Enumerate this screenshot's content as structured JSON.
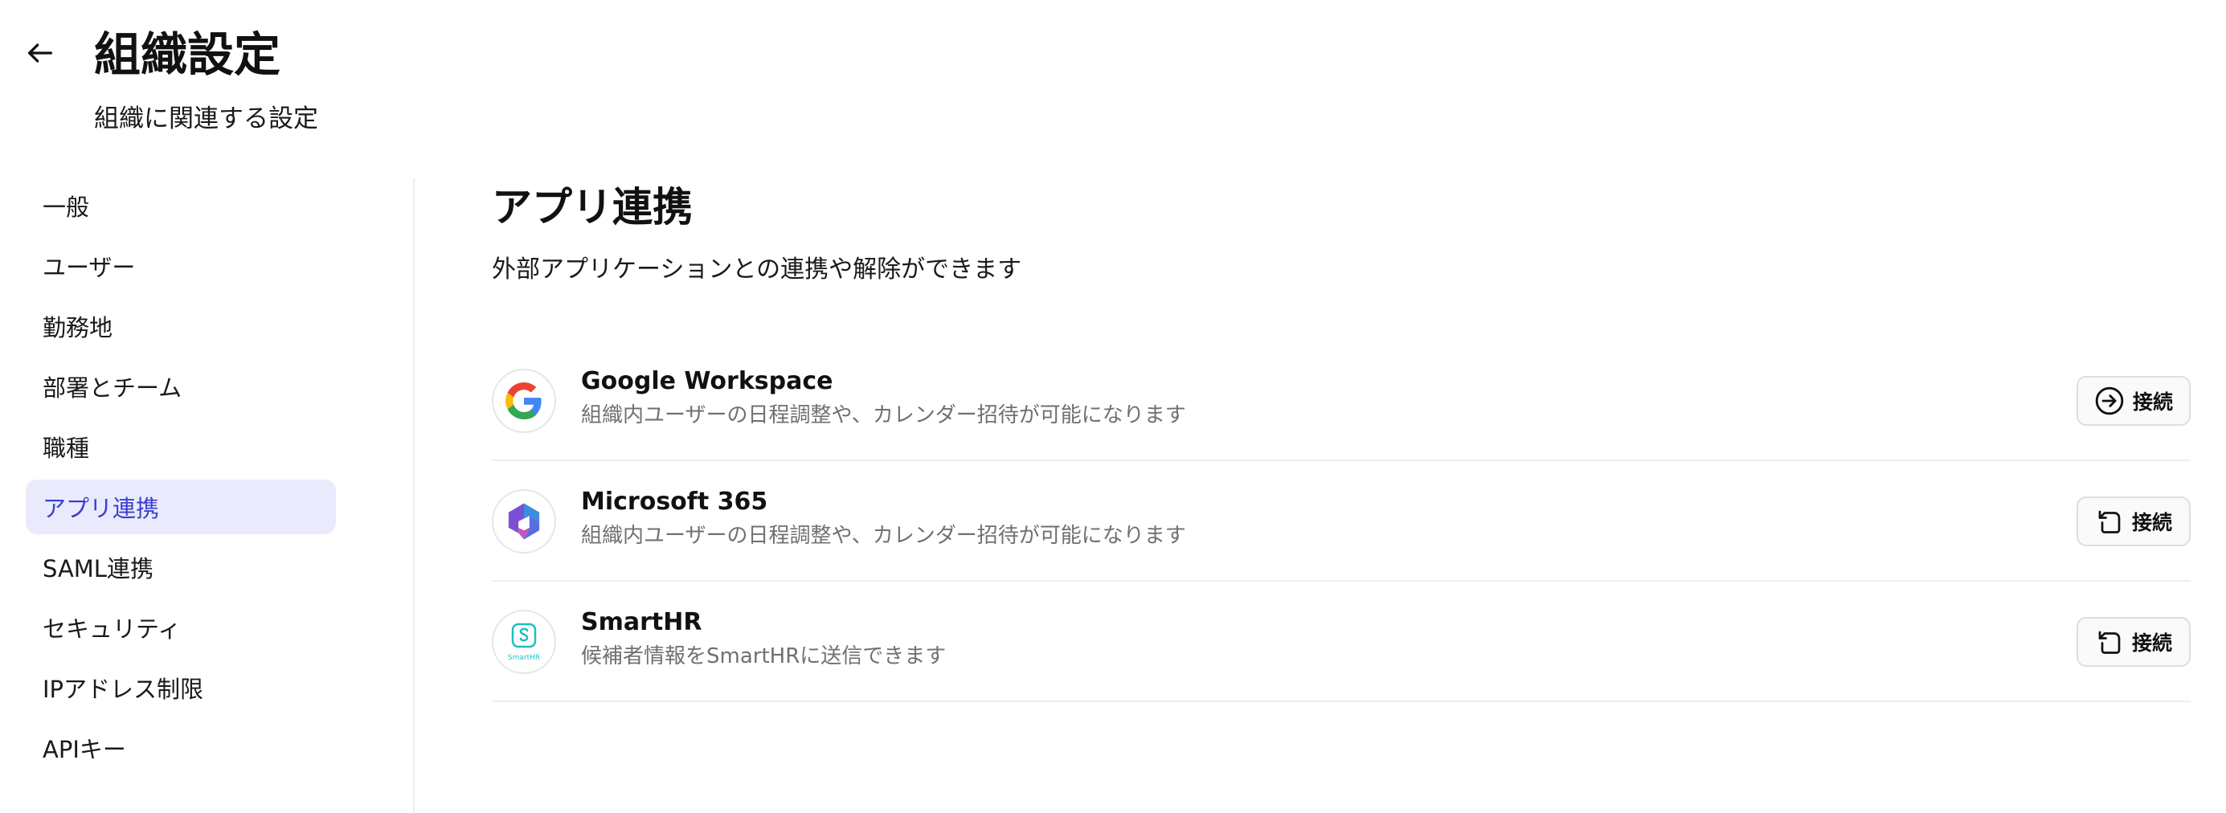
{
  "header": {
    "title": "組織設定",
    "subtitle": "組織に関連する設定",
    "back_icon": "arrow-left-icon"
  },
  "sidebar": {
    "active_index": 5,
    "items": [
      {
        "label": "一般"
      },
      {
        "label": "ユーザー"
      },
      {
        "label": "勤務地"
      },
      {
        "label": "部署とチーム"
      },
      {
        "label": "職種"
      },
      {
        "label": "アプリ連携"
      },
      {
        "label": "SAML連携"
      },
      {
        "label": "セキュリティ"
      },
      {
        "label": "IPアドレス制限"
      },
      {
        "label": "APIキー"
      }
    ]
  },
  "main": {
    "title": "アプリ連携",
    "description": "外部アプリケーションとの連携や解除ができます",
    "apps": [
      {
        "name": "Google Workspace",
        "description": "組織内ユーザーの日程調整や、カレンダー招待が可能になります",
        "button_label": "接続",
        "button_icon": "sign-in-icon",
        "logo": "google-logo-icon"
      },
      {
        "name": "Microsoft 365",
        "description": "組織内ユーザーの日程調整や、カレンダー招待が可能になります",
        "button_label": "接続",
        "button_icon": "rotate-left-icon",
        "logo": "microsoft-365-logo-icon"
      },
      {
        "name": "SmartHR",
        "description": "候補者情報をSmartHRに送信できます",
        "button_label": "接続",
        "button_icon": "rotate-left-icon",
        "logo": "smarthr-logo-icon",
        "logo_text": "SmartHR"
      }
    ]
  },
  "colors": {
    "active_bg": "#e9ebfc",
    "active_text": "#3b3fd0",
    "muted_text": "#707070",
    "smarthr_teal": "#1fbec3"
  }
}
